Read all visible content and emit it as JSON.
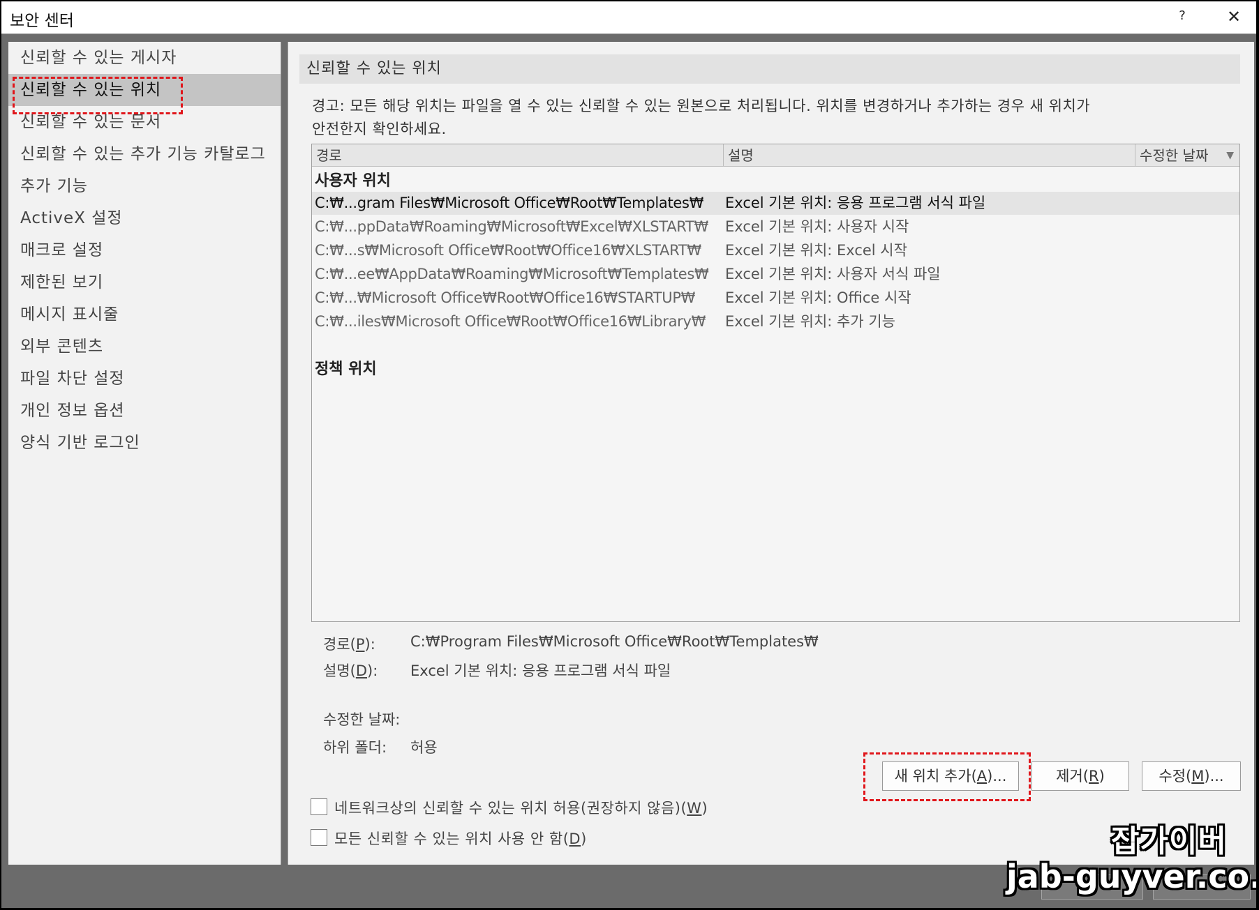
{
  "window": {
    "title": "보안 센터",
    "help_glyph": "?",
    "close_glyph": "✕"
  },
  "sidebar": {
    "items": [
      {
        "label": "신뢰할 수 있는 게시자"
      },
      {
        "label": "신뢰할 수 있는 위치",
        "active": true
      },
      {
        "label": "신뢰할 수 있는 문서"
      },
      {
        "label": "신뢰할 수 있는 추가 기능 카탈로그"
      },
      {
        "label": "추가 기능"
      },
      {
        "label": "ActiveX 설정"
      },
      {
        "label": "매크로 설정"
      },
      {
        "label": "제한된 보기"
      },
      {
        "label": "메시지 표시줄"
      },
      {
        "label": "외부 콘텐츠"
      },
      {
        "label": "파일 차단 설정"
      },
      {
        "label": "개인 정보 옵션"
      },
      {
        "label": "양식 기반 로그인"
      }
    ]
  },
  "main": {
    "section_title": "신뢰할 수 있는 위치",
    "warning_line1": "경고: 모든 해당 위치는 파일을 열 수 있는 신뢰할 수 있는 원본으로 처리됩니다. 위치를 변경하거나 추가하는 경우 새 위치가",
    "warning_line2": "안전한지 확인하세요.",
    "columns": {
      "path": "경로",
      "description": "설명",
      "modified": "수정한 날짜"
    },
    "user_locations_heading": "사용자 위치",
    "user_locations": [
      {
        "path": "C:₩...gram Files₩Microsoft Office₩Root₩Templates₩",
        "description": "Excel 기본 위치: 응용 프로그램 서식 파일",
        "selected": true
      },
      {
        "path": "C:₩...ppData₩Roaming₩Microsoft₩Excel₩XLSTART₩",
        "description": "Excel 기본 위치: 사용자 시작"
      },
      {
        "path": "C:₩...s₩Microsoft Office₩Root₩Office16₩XLSTART₩",
        "description": "Excel 기본 위치: Excel 시작"
      },
      {
        "path": "C:₩...ee₩AppData₩Roaming₩Microsoft₩Templates₩",
        "description": "Excel 기본 위치: 사용자 서식 파일"
      },
      {
        "path": "C:₩...₩Microsoft Office₩Root₩Office16₩STARTUP₩",
        "description": "Excel 기본 위치: Office 시작"
      },
      {
        "path": "C:₩...iles₩Microsoft Office₩Root₩Office16₩Library₩",
        "description": "Excel 기본 위치: 추가 기능"
      }
    ],
    "policy_locations_heading": "정책 위치",
    "details": {
      "path_label_pre": "경로(",
      "path_label_key": "P",
      "path_label_post": "):",
      "path_value": "C:₩Program Files₩Microsoft Office₩Root₩Templates₩",
      "desc_label_pre": "설명(",
      "desc_label_key": "D",
      "desc_label_post": "):",
      "desc_value": "Excel 기본 위치: 응용 프로그램 서식 파일",
      "modified_label": "수정한 날짜:",
      "subfolders_label": "하위 폴더:",
      "subfolders_value": "허용"
    },
    "buttons": {
      "add_pre": "새 위치 추가(",
      "add_key": "A",
      "add_post": ")...",
      "remove_pre": "제거(",
      "remove_key": "R",
      "remove_post": ")",
      "modify_pre": "수정(",
      "modify_key": "M",
      "modify_post": ")..."
    },
    "checkboxes": {
      "network_pre": "네트워크상의 신뢰할 수 있는 위치 허용(권장하지 않음)(",
      "network_key": "W",
      "network_post": ")",
      "network_checked": false,
      "disable_pre": "모든 신뢰할 수 있는 위치 사용 안 함(",
      "disable_key": "D",
      "disable_post": ")",
      "disable_checked": false
    }
  },
  "watermark": {
    "line1": "잡가이버",
    "line2": "jab-guyver.co.kr"
  },
  "colors": {
    "highlight_dash": "#e0161b",
    "panel_bg": "#f2f2f2",
    "selected_row": "#e4e4e4",
    "active_nav": "#c4c4c4"
  }
}
